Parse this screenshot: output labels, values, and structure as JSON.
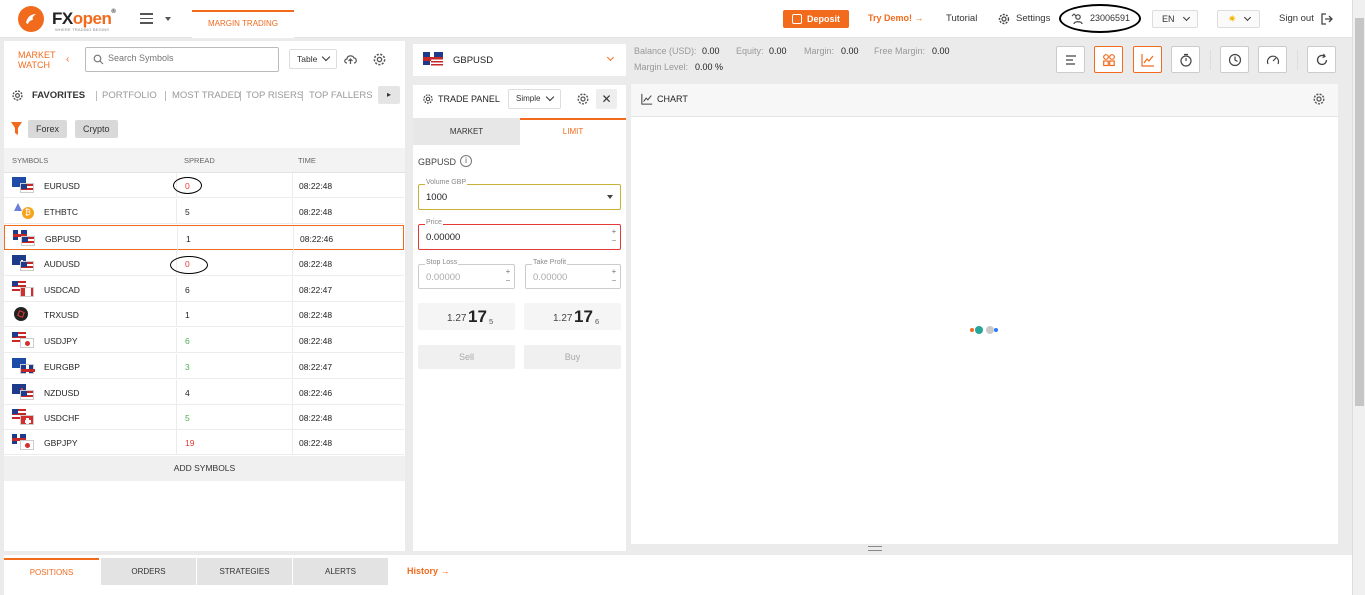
{
  "header": {
    "logo_text_a": "FX",
    "logo_text_b": "open",
    "logo_tagline": "WHERE TRADING BEGINS",
    "tab_margin": "MARGIN TRADING",
    "deposit_label": "Deposit",
    "try_demo_label": "Try Demo!",
    "tutorial_label": "Tutorial",
    "settings_label": "Settings",
    "account_number": "23006591",
    "language": "EN",
    "signout_label": "Sign out"
  },
  "market_watch": {
    "title_line1": "MARKET",
    "title_line2": "WATCH",
    "search_placeholder": "Search Symbols",
    "view_select": "Table",
    "filter_tabs": [
      "FAVORITES",
      "PORTFOLIO",
      "MOST TRADED",
      "TOP RISERS",
      "TOP FALLERS"
    ],
    "chips": [
      "Forex",
      "Crypto"
    ],
    "columns": [
      "SYMBOLS",
      "SPREAD",
      "TIME"
    ],
    "rows": [
      {
        "symbol": "EURUSD",
        "spread": "0",
        "time": "08:22:48"
      },
      {
        "symbol": "ETHBTC",
        "spread": "5",
        "time": "08:22:48"
      },
      {
        "symbol": "GBPUSD",
        "spread": "1",
        "time": "08:22:46"
      },
      {
        "symbol": "AUDUSD",
        "spread": "0",
        "time": "08:22:48"
      },
      {
        "symbol": "USDCAD",
        "spread": "6",
        "time": "08:22:47"
      },
      {
        "symbol": "TRXUSD",
        "spread": "1",
        "time": "08:22:48"
      },
      {
        "symbol": "USDJPY",
        "spread": "6",
        "time": "08:22:48"
      },
      {
        "symbol": "EURGBP",
        "spread": "3",
        "time": "08:22:47"
      },
      {
        "symbol": "NZDUSD",
        "spread": "4",
        "time": "08:22:46"
      },
      {
        "symbol": "USDCHF",
        "spread": "5",
        "time": "08:22:48"
      },
      {
        "symbol": "GBPJPY",
        "spread": "19",
        "time": "08:22:48"
      }
    ],
    "add_symbols_label": "ADD SYMBOLS"
  },
  "instrument": {
    "symbol": "GBPUSD"
  },
  "trade_panel": {
    "title": "TRADE PANEL",
    "mode_select": "Simple",
    "tabs": [
      "MARKET",
      "LIMIT"
    ],
    "symbol": "GBPUSD",
    "volume_label": "Volume GBP",
    "volume_value": "1000",
    "price_label": "Price",
    "price_value": "0.00000",
    "stop_loss_label": "Stop Loss",
    "stop_loss_value": "0.00000",
    "take_profit_label": "Take Profit",
    "take_profit_value": "0.00000",
    "sell_price": {
      "a": "1.27",
      "b": "17",
      "c": "5"
    },
    "buy_price": {
      "a": "1.27",
      "b": "17",
      "c": "6"
    },
    "sell_label": "Sell",
    "buy_label": "Buy"
  },
  "account": {
    "balance_label": "Balance  (USD):",
    "balance": "0.00",
    "equity_label": "Equity:",
    "equity": "0.00",
    "margin_label": "Margin:",
    "margin": "0.00",
    "free_margin_label": "Free Margin:",
    "free_margin": "0.00",
    "margin_level_label": "Margin Level:",
    "margin_level": "0.00 %"
  },
  "chart": {
    "title": "CHART"
  },
  "bottom": {
    "tabs": [
      "POSITIONS",
      "ORDERS",
      "STRATEGIES",
      "ALERTS"
    ],
    "history_label": "History"
  },
  "colors": {
    "accent": "#f26b1d",
    "spread_red": "#e53935",
    "spread_green": "#4caf50"
  }
}
